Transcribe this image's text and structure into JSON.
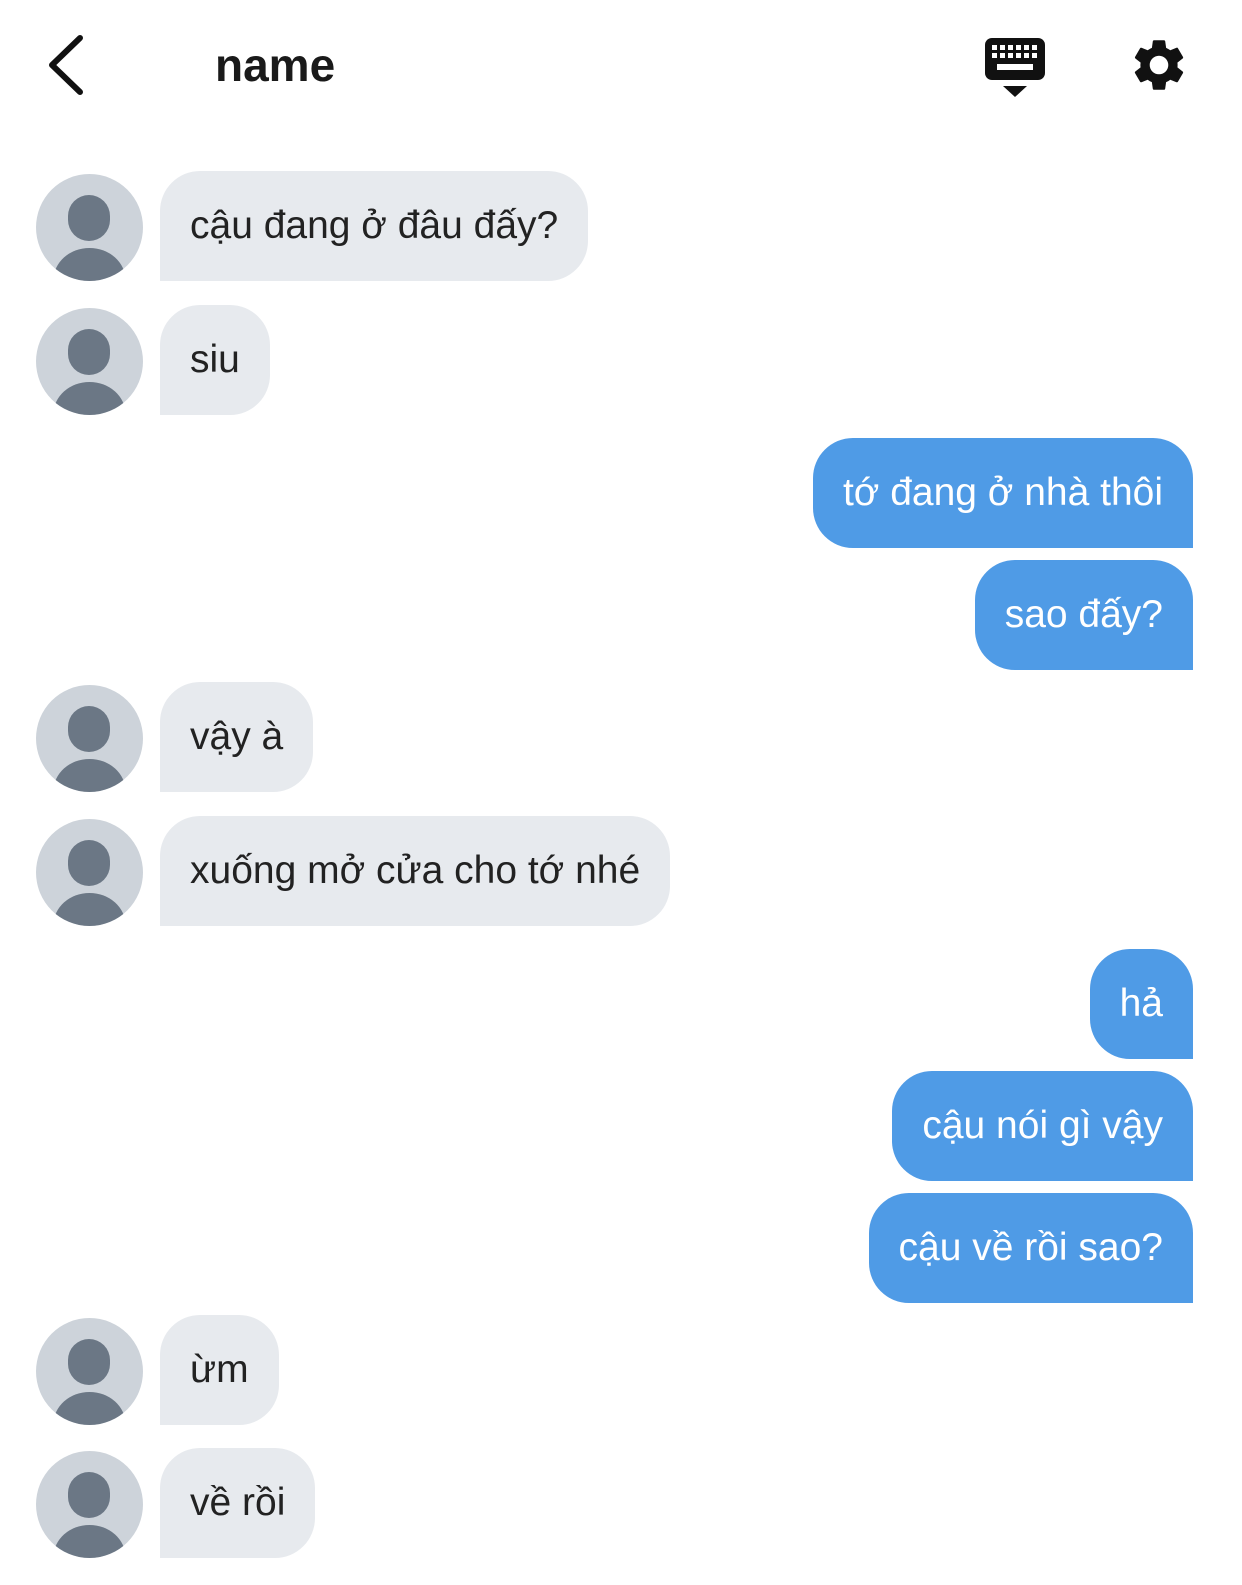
{
  "header": {
    "title": "name",
    "back_icon": "chevron-left-icon",
    "keyboard_icon": "keyboard-icon",
    "settings_icon": "gear-icon"
  },
  "colors": {
    "incoming_bubble": "#e7eaee",
    "outgoing_bubble": "#4f9be6",
    "avatar_bg": "#cdd3da",
    "avatar_figure": "#6b7785"
  },
  "messages": [
    {
      "side": "in",
      "text": "cậu đang ở đâu đấy?"
    },
    {
      "side": "in",
      "text": "siu"
    },
    {
      "side": "out",
      "text": "tớ đang ở nhà thôi"
    },
    {
      "side": "out",
      "text": "sao đấy?"
    },
    {
      "side": "in",
      "text": "vậy à"
    },
    {
      "side": "in",
      "text": "xuống mở cửa cho tớ nhé"
    },
    {
      "side": "out",
      "text": "hả"
    },
    {
      "side": "out",
      "text": "cậu nói gì vậy"
    },
    {
      "side": "out",
      "text": "cậu về rồi sao?"
    },
    {
      "side": "in",
      "text": "ừm"
    },
    {
      "side": "in",
      "text": "về rồi"
    }
  ]
}
